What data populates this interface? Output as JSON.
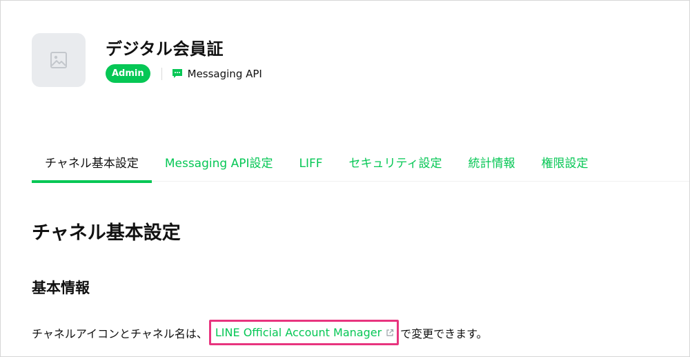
{
  "channel": {
    "title": "デジタル会員証",
    "role_badge": "Admin",
    "type_label": "Messaging API",
    "icon": "image-placeholder-icon",
    "type_icon": "chat-bubble-icon"
  },
  "tabs": [
    {
      "label": "チャネル基本設定",
      "active": true
    },
    {
      "label": "Messaging API設定",
      "active": false
    },
    {
      "label": "LIFF",
      "active": false
    },
    {
      "label": "セキュリティ設定",
      "active": false
    },
    {
      "label": "統計情報",
      "active": false
    },
    {
      "label": "権限設定",
      "active": false
    }
  ],
  "content": {
    "section_title": "チャネル基本設定",
    "subsection_title": "基本情報",
    "desc_prefix": "チャネルアイコンとチャネル名は、",
    "link_text": "LINE Official Account Manager",
    "link_icon": "external-link-icon",
    "desc_suffix": "で変更できます。"
  },
  "colors": {
    "brand_green": "#06c755",
    "highlight_pink": "#e8347e",
    "icon_bg": "#e9ebee"
  }
}
